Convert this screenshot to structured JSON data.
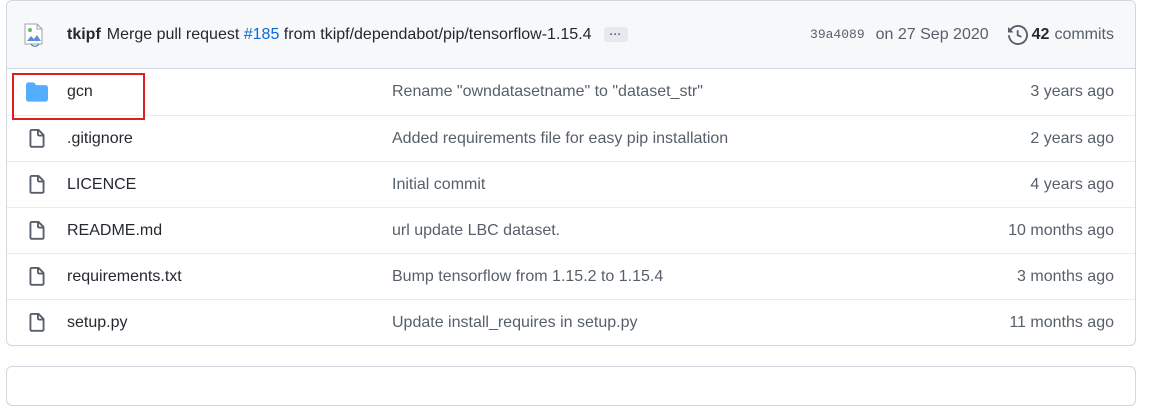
{
  "commit": {
    "author": "tkipf",
    "message_prefix": "Merge pull request",
    "pr_number": "#185",
    "message_suffix": "from tkipf/dependabot/pip/tensorflow-1.15.4",
    "ellipsis": "...",
    "sha": "39a4089",
    "date": "on 27 Sep 2020",
    "commit_count": "42",
    "commits_label": "commits"
  },
  "files": [
    {
      "name": "gcn",
      "type": "folder",
      "message": "Rename \"owndatasetname\" to \"dataset_str\"",
      "age": "3 years ago"
    },
    {
      "name": ".gitignore",
      "type": "file",
      "message": "Added requirements file for easy pip installation",
      "age": "2 years ago"
    },
    {
      "name": "LICENCE",
      "type": "file",
      "message": "Initial commit",
      "age": "4 years ago"
    },
    {
      "name": "README.md",
      "type": "file",
      "message": "url update LBC dataset.",
      "age": "10 months ago"
    },
    {
      "name": "requirements.txt",
      "type": "file",
      "message": "Bump tensorflow from 1.15.2 to 1.15.4",
      "age": "3 months ago"
    },
    {
      "name": "setup.py",
      "type": "file",
      "message": "Update install_requires in setup.py",
      "age": "11 months ago"
    }
  ],
  "colors": {
    "folder": "#54aeff",
    "link": "#0969da",
    "highlight": "#e02020"
  }
}
